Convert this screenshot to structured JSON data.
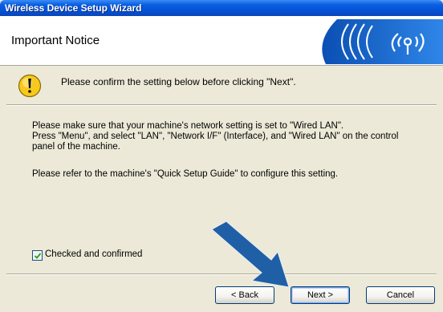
{
  "window": {
    "title": "Wireless Device Setup Wizard",
    "heading": "Important Notice"
  },
  "notice": {
    "icon": "warning-icon",
    "text": "Please confirm the setting below before clicking \"Next\"."
  },
  "body": {
    "line1": "Please make sure that your machine's network setting is set to \"Wired LAN\".",
    "line2": "Press \"Menu\", and select \"LAN\", \"Network I/F\" (Interface), and \"Wired LAN\" on the control",
    "line3": "panel of the machine.",
    "line4": "Please refer to the machine's \"Quick Setup Guide\" to configure this setting."
  },
  "confirm": {
    "label": "Checked and confirmed",
    "checked": true
  },
  "buttons": {
    "back": "< Back",
    "next": "Next >",
    "cancel": "Cancel"
  },
  "colors": {
    "titlebar": "#0a5fe0",
    "dialog_bg": "#ece9d8",
    "arrow": "#1f5fa6",
    "logo_blue": "#1566c8"
  }
}
